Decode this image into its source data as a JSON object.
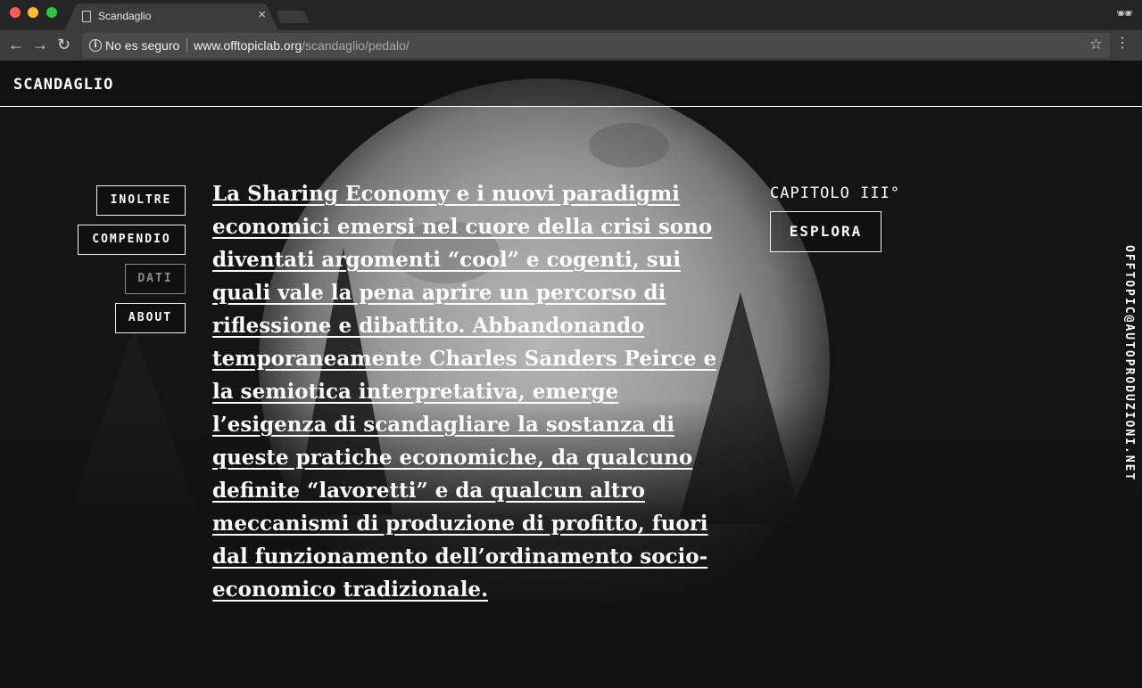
{
  "browser": {
    "tab_title": "Scandaglio",
    "tab_close": "×",
    "security_label": "No es seguro",
    "url_host": "www.offtopiclab.org",
    "url_path": "/scandaglio/pedalo/",
    "icons": [
      "back-arrow-icon",
      "forward-arrow-icon",
      "reload-icon",
      "info-icon",
      "star-icon",
      "menu-icon",
      "incognito-icon",
      "page-icon"
    ]
  },
  "site": {
    "logo": "SCANDAGLIO"
  },
  "nav": {
    "items": [
      {
        "label": "INOLTRE"
      },
      {
        "label": "COMPENDIO"
      },
      {
        "label": "DATI"
      },
      {
        "label": "ABOUT"
      }
    ]
  },
  "main": {
    "intro": "La Sharing Economy e i nuovi paradigmi economici emersi nel cuore della crisi sono diventati argomenti “cool” e cogenti, sui quali vale la pena aprire un percorso di riflessione e dibattito. Abbandonando temporaneamente Charles Sanders Peirce e la semiotica interpretativa, emerge l’esigenza di scandagliare la sostanza di queste pratiche economiche, da qualcuno definite “lavoretti” e da qualcun altro meccanismi di produzione di profitto, fuori dal funzionamento dell’ordinamento socio-economico tradizionale."
  },
  "chapter": {
    "label": "CAPITOLO III°",
    "button": "ESPLORA"
  },
  "contact": {
    "email": "OFFTOPIC@AUTOPRODUZIONI.NET"
  },
  "colors": {
    "chrome_bg": "#252525",
    "toolbar_bg": "#3c3c3c",
    "page_bg": "#141414",
    "text": "#ffffff"
  }
}
